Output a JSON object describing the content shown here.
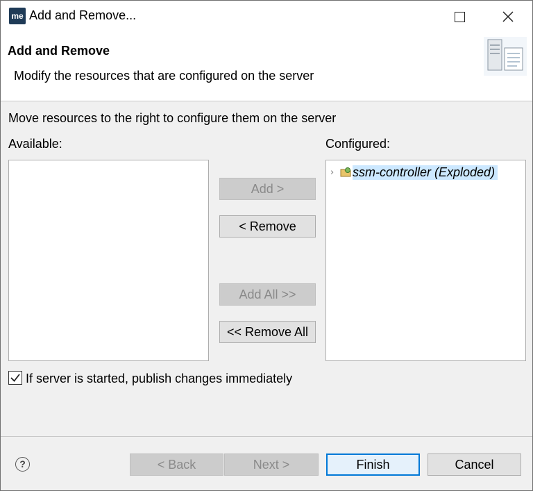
{
  "window": {
    "app_icon_text": "me",
    "title": "Add and Remove..."
  },
  "header": {
    "title": "Add and Remove",
    "description": "Modify the resources that are configured on the server"
  },
  "main": {
    "instruction": "Move resources to the right to configure them on the server",
    "available_label": "Available:",
    "configured_label": "Configured:",
    "available_items": [],
    "configured_items": [
      {
        "label": "ssm-controller (Exploded)",
        "selected": true
      }
    ]
  },
  "buttons": {
    "add": "Add >",
    "remove": "< Remove",
    "add_all": "Add All >>",
    "remove_all": "<< Remove All"
  },
  "publish_checkbox": {
    "label": "If server is started, publish changes immediately",
    "checked": true
  },
  "footer": {
    "help": "?",
    "back": "< Back",
    "next": "Next >",
    "finish": "Finish",
    "cancel": "Cancel"
  },
  "colors": {
    "selection": "#cce8ff",
    "default_button_border": "#0078d7",
    "disabled_text": "#8a8a8a"
  }
}
